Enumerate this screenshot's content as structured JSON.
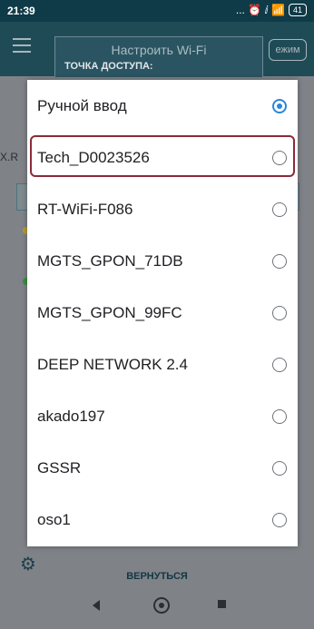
{
  "status_bar": {
    "time": "21:39",
    "icons_text": "... ⏰ ⅈ 📶",
    "battery": "41"
  },
  "app": {
    "header_title": "Настроить Wi-Fi",
    "header_subtitle": "ТОЧКА ДОСТУПА:",
    "mode_button": "ежим",
    "left_text": "X.R",
    "back_label": "ВЕРНУТЬСЯ"
  },
  "dialog": {
    "options": [
      {
        "label": "Ручной ввод",
        "selected": true
      },
      {
        "label": "Tech_D0023526",
        "selected": false,
        "highlighted": true
      },
      {
        "label": "RT-WiFi-F086",
        "selected": false
      },
      {
        "label": "MGTS_GPON_71DB",
        "selected": false
      },
      {
        "label": "MGTS_GPON_99FC",
        "selected": false
      },
      {
        "label": "DEEP NETWORK 2.4",
        "selected": false
      },
      {
        "label": "akado197",
        "selected": false
      },
      {
        "label": "GSSR",
        "selected": false
      },
      {
        "label": "oso1",
        "selected": false
      }
    ]
  },
  "colors": {
    "accent": "#2a86d9",
    "highlight_border": "#8b2a38",
    "status_bar": "#0f3a47"
  }
}
